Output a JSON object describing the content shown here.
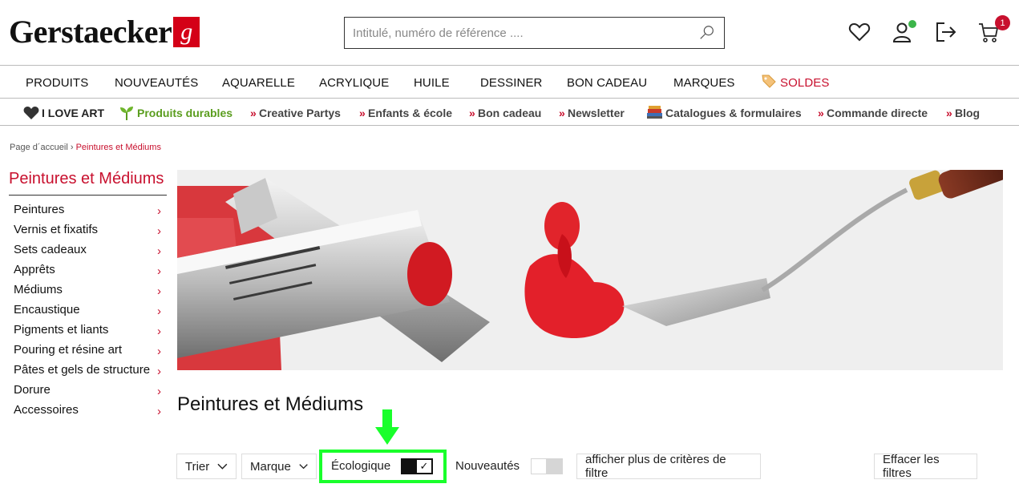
{
  "header": {
    "logo_text": "Gerstaecker",
    "logo_mark": "g",
    "search_placeholder": "Intitulé, numéro de référence ....",
    "cart_count": "1",
    "colors": {
      "brand_red": "#c8102e",
      "online_dot": "#3cb54a"
    }
  },
  "main_nav": [
    {
      "label": "PRODUITS"
    },
    {
      "label": "NOUVEAUTÉS"
    },
    {
      "label": "AQUARELLE"
    },
    {
      "label": "ACRYLIQUE"
    },
    {
      "label": "HUILE"
    },
    {
      "label": "DESSINER"
    },
    {
      "label": "BON CADEAU"
    },
    {
      "label": "MARQUES"
    },
    {
      "label": "SOLDES"
    }
  ],
  "sub_nav": [
    {
      "label": "I LOVE ART",
      "icon": "heart-icon"
    },
    {
      "label": "Produits durables",
      "icon": "sprout-icon"
    },
    {
      "label": "Creative Partys",
      "prefix": "»"
    },
    {
      "label": "Enfants & école",
      "prefix": "»"
    },
    {
      "label": "Bon cadeau",
      "prefix": "»"
    },
    {
      "label": "Newsletter",
      "prefix": "»"
    },
    {
      "label": "Catalogues & formulaires",
      "icon": "books-icon"
    },
    {
      "label": "Commande directe",
      "prefix": "»"
    },
    {
      "label": "Blog",
      "prefix": "»"
    }
  ],
  "breadcrumb": {
    "home": "Page d´accueil",
    "separator": "›",
    "current": "Peintures et Médiums"
  },
  "sidebar": {
    "title": "Peintures et Médiums",
    "items": [
      {
        "label": "Peintures"
      },
      {
        "label": "Vernis et fixatifs"
      },
      {
        "label": "Sets cadeaux"
      },
      {
        "label": "Apprêts"
      },
      {
        "label": "Médiums"
      },
      {
        "label": "Encaustique"
      },
      {
        "label": "Pigments et liants"
      },
      {
        "label": "Pouring et résine art"
      },
      {
        "label": "Pâtes et gels de structure"
      },
      {
        "label": "Dorure"
      },
      {
        "label": "Accessoires"
      }
    ],
    "chevron": "›"
  },
  "page_title": "Peintures et Médiums",
  "filters": {
    "sort_label": "Trier",
    "brand_label": "Marque",
    "eco_label": "Écologique",
    "eco_enabled": true,
    "eco_check": "✓",
    "new_label": "Nouveautés",
    "new_enabled": false,
    "more_label": "afficher plus de critères de filtre",
    "clear_label": "Effacer les filtres"
  },
  "highlight": {
    "color": "#19ff2b"
  }
}
